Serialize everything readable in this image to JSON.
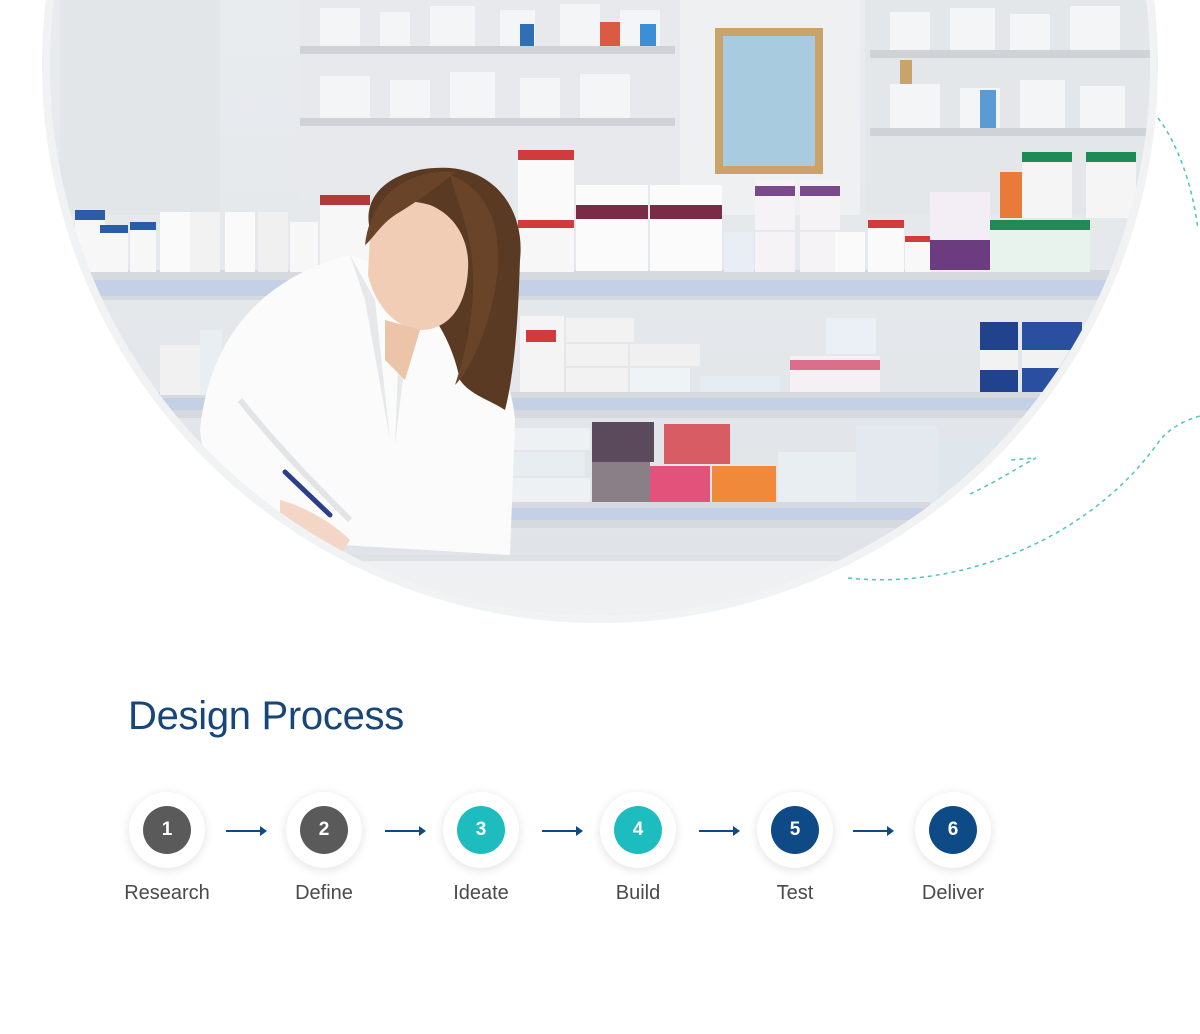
{
  "section": {
    "title": "Design Process"
  },
  "steps": [
    {
      "number": "1",
      "label": "Research",
      "color": "#5a5a5a"
    },
    {
      "number": "2",
      "label": "Define",
      "color": "#5a5a5a"
    },
    {
      "number": "3",
      "label": "Ideate",
      "color": "#1cbcbf"
    },
    {
      "number": "4",
      "label": "Build",
      "color": "#1cbcbf"
    },
    {
      "number": "5",
      "label": "Test",
      "color": "#0d4a86"
    },
    {
      "number": "6",
      "label": "Deliver",
      "color": "#0d4a86"
    }
  ],
  "colors": {
    "title": "#17467a",
    "arrow": "#0d4a86",
    "dashed_line": "#4fc3c3"
  },
  "icons": {
    "connector": "arrow-right-icon"
  }
}
